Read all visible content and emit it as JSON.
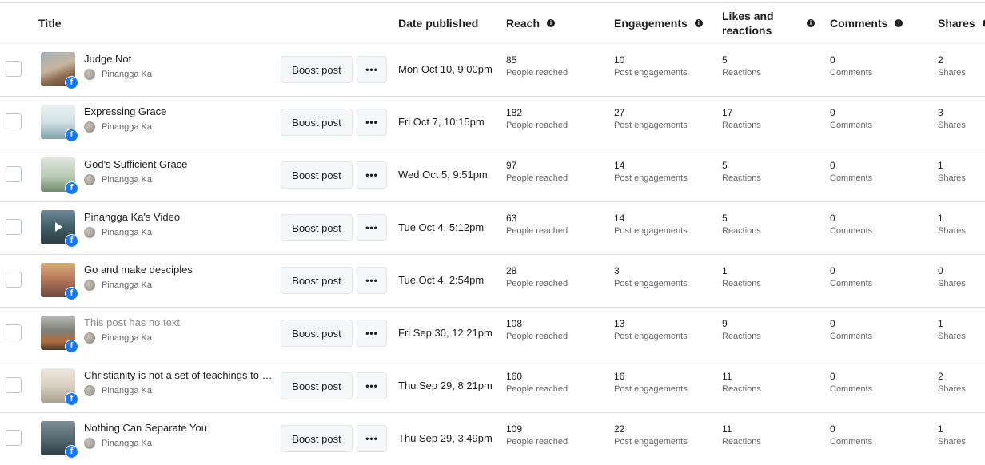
{
  "header": {
    "title": "Title",
    "date_published": "Date published",
    "reach": "Reach",
    "engagements": "Engagements",
    "likes_line1": "Likes and",
    "likes_line2": "reactions",
    "comments": "Comments",
    "shares": "Shares"
  },
  "labels": {
    "boost": "Boost post",
    "more": "•••",
    "reach": "People reached",
    "engagements": "Post engagements",
    "reactions": "Reactions",
    "comments": "Comments",
    "shares": "Shares",
    "author": "Pinangga Ka",
    "fb_badge": "f"
  },
  "rows": [
    {
      "title": "Judge Not",
      "muted": false,
      "thumb": "photo-hands",
      "date": "Mon Oct 10, 9:00pm",
      "reach": "85",
      "engagements": "10",
      "reactions": "5",
      "comments": "0",
      "shares": "2"
    },
    {
      "title": "Expressing Grace",
      "muted": false,
      "thumb": "text-card-teal",
      "date": "Fri Oct 7, 10:15pm",
      "reach": "182",
      "engagements": "27",
      "reactions": "17",
      "comments": "0",
      "shares": "3"
    },
    {
      "title": "God's Sufficient Grace",
      "muted": false,
      "thumb": "text-card-green",
      "date": "Wed Oct 5, 9:51pm",
      "reach": "97",
      "engagements": "14",
      "reactions": "5",
      "comments": "0",
      "shares": "1"
    },
    {
      "title": "Pinangga Ka's Video",
      "muted": false,
      "thumb": "video-landscape",
      "date": "Tue Oct 4, 5:12pm",
      "reach": "63",
      "engagements": "14",
      "reactions": "5",
      "comments": "0",
      "shares": "1"
    },
    {
      "title": "Go and make desciples",
      "muted": false,
      "thumb": "photo-sunset",
      "date": "Tue Oct 4, 2:54pm",
      "reach": "28",
      "engagements": "3",
      "reactions": "1",
      "comments": "0",
      "shares": "0"
    },
    {
      "title": "This post has no text",
      "muted": true,
      "thumb": "photo-mountain",
      "date": "Fri Sep 30, 12:21pm",
      "reach": "108",
      "engagements": "13",
      "reactions": "9",
      "comments": "0",
      "shares": "1"
    },
    {
      "title": "Christianity is not a set of teachings to un...",
      "muted": false,
      "thumb": "photo-book",
      "date": "Thu Sep 29, 8:21pm",
      "reach": "160",
      "engagements": "16",
      "reactions": "11",
      "comments": "0",
      "shares": "2"
    },
    {
      "title": "Nothing Can Separate You",
      "muted": false,
      "thumb": "text-card-dark",
      "date": "Thu Sep 29, 3:49pm",
      "reach": "109",
      "engagements": "22",
      "reactions": "11",
      "comments": "0",
      "shares": "1"
    }
  ]
}
